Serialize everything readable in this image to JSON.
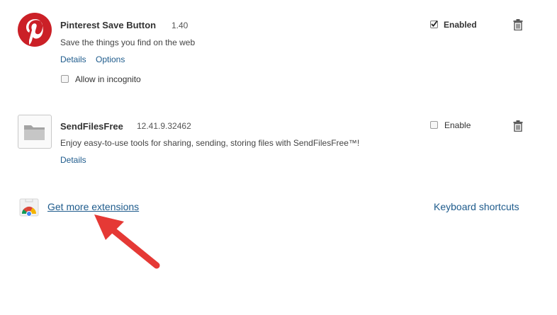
{
  "extensions": [
    {
      "name": "Pinterest Save Button",
      "version": "1.40",
      "description": "Save the things you find on the web",
      "links": [
        "Details",
        "Options"
      ],
      "incognito_label": "Allow in incognito",
      "enable_label": "Enabled",
      "enabled": true,
      "icon": "pinterest-logo-icon"
    },
    {
      "name": "SendFilesFree",
      "version": "12.41.9.32462",
      "description": "Enjoy easy-to-use tools for sharing, sending, storing files with SendFilesFree™!",
      "links": [
        "Details"
      ],
      "enable_label": "Enable",
      "enabled": false,
      "icon": "folder-icon"
    }
  ],
  "footer": {
    "get_more_label": "Get more extensions",
    "keyboard_shortcuts_label": "Keyboard shortcuts",
    "store_icon": "chrome-web-store-icon"
  },
  "colors": {
    "pinterest_red": "#cb2027",
    "link_blue": "#1e5b8c",
    "arrow_red": "#e53935"
  }
}
